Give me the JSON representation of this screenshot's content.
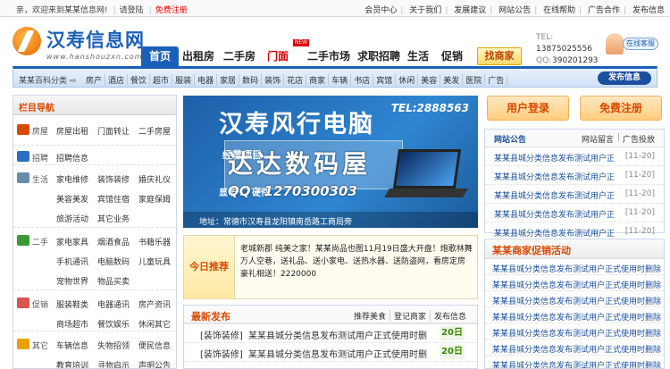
{
  "topbar": {
    "welcome": "亲，欢迎来到某某信息网!",
    "login": "请登陆",
    "register": "免费注册",
    "links": [
      "会员中心",
      "关于我们",
      "发展建议",
      "网站公告",
      "在线帮助",
      "广告合作",
      "发布信息"
    ]
  },
  "logo": {
    "name": "汉寿信息网",
    "url": "www.hanshouzxn.com"
  },
  "nav": {
    "tabs": [
      "首页",
      "出租房",
      "二手房",
      "门面",
      "二手市场",
      "求职招聘",
      "生活",
      "促销"
    ],
    "new_badge": "NEW",
    "enterprise": "找商家"
  },
  "contact": {
    "tel": "13875025556",
    "qq": "390201293",
    "service": "在线客服"
  },
  "category_bar": {
    "lead": "某某百科分类",
    "items": [
      "房产",
      "酒店",
      "餐饮",
      "超市",
      "服装",
      "电器",
      "家居",
      "数码",
      "装饰",
      "花店",
      "商家",
      "车辆",
      "书店",
      "宾馆",
      "休闲",
      "美容",
      "美发",
      "医院",
      "广告"
    ],
    "publish": "发布信息"
  },
  "sidebar": {
    "title": "栏目导航",
    "sections": [
      {
        "name": "房屋",
        "color": "#d94a00",
        "items": [
          "房屋出租",
          "门面转让",
          "二手房屋"
        ]
      },
      {
        "name": "招聘",
        "color": "#2a6fc0",
        "items": [
          "招聘信息"
        ]
      },
      {
        "name": "生活",
        "color": "#6a8bb0",
        "items": [
          "家电维修",
          "装饰装修",
          "婚庆礼仪",
          "美容美发",
          "宾馆住宿",
          "家庭保姆",
          "旅游活动",
          "其它业务"
        ]
      },
      {
        "name": "二手",
        "color": "#3a9a3a",
        "items": [
          "家电家具",
          "烟酒食品",
          "书籍乐器",
          "手机通讯",
          "电脑数码",
          "儿童玩具",
          "宠物世界",
          "物品买卖"
        ]
      },
      {
        "name": "促销",
        "color": "#d9534f",
        "items": [
          "服装鞋类",
          "电器通讯",
          "房产资讯",
          "商场超市",
          "餐饮娱乐",
          "休闲其它"
        ]
      },
      {
        "name": "其它",
        "color": "#e8a000",
        "items": [
          "车辆信息",
          "失物招领",
          "便民信息",
          "教育培训",
          "寻物启示",
          "声明公告"
        ]
      }
    ]
  },
  "banner": {
    "title": "汉寿风行电脑",
    "tel": "TEL:2888563",
    "line2": "经营项目",
    "line3": "显卡  …  硬件",
    "watermark": "达达数码屋",
    "watermark_qq": "QQ：1270300303",
    "address": "地址：常德市汉寿县龙阳镇南岳路工商局旁"
  },
  "recommend": {
    "label": "今日推荐",
    "text": "老城新郡 纯美之家！某某尚品也图11月19日盛大开盘！炮歌林舞万人空巷，送礼品、送小家电、送热水器、送防盗网，看房定房豪礼相送！2220000"
  },
  "news": {
    "title": "最新发布",
    "links": [
      "推荐美食",
      "登记商家",
      "发布信息"
    ],
    "rows": [
      {
        "tag": "[装饰装修]",
        "title": "某某县城分类信息发布测试用户正式使用时删",
        "date": "20日"
      },
      {
        "tag": "[装饰装修]",
        "title": "某某县城分类信息发布测试用户正式使用时删",
        "date": "20日"
      }
    ]
  },
  "right": {
    "login_btn": "用户登录",
    "register_btn": "免费注册",
    "notice_tabs": [
      "网站公告",
      "网站留言",
      "广告投放"
    ],
    "notices": [
      {
        "title": "某某县城分类信息发布测试用户正",
        "date": "[11-20]"
      },
      {
        "title": "某某县城分类信息发布测试用户正",
        "date": "[11-20]"
      },
      {
        "title": "某某县城分类信息发布测试用户正",
        "date": "[11-20]"
      },
      {
        "title": "某某县城分类信息发布测试用户正",
        "date": "[11-20]"
      },
      {
        "title": "某某县城分类信息发布测试用户正",
        "date": "[11-20]"
      }
    ],
    "promo_title": "某某商家促销活动",
    "promos": [
      "某某县城分类信息发布测试用户正式使用时删除",
      "某某县城分类信息发布测试用户正式使用时删除",
      "某某县城分类信息发布测试用户正式使用时删除",
      "某某县城分类信息发布测试用户正式使用时删除",
      "某某县城分类信息发布测试用户正式使用时删除",
      "某某县城分类信息发布测试用户正式使用时删除",
      "某某县城分类信息发布测试用户正式使用时删除"
    ]
  }
}
